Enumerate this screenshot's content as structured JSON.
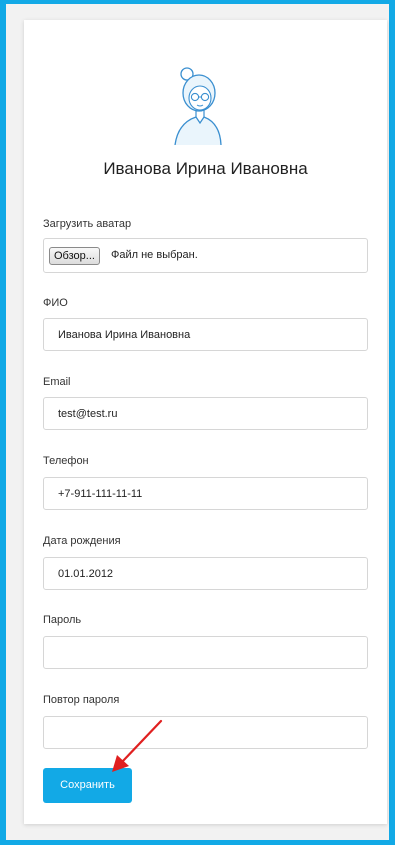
{
  "profile": {
    "name": "Иванова Ирина Ивановна"
  },
  "form": {
    "avatar_label": "Загрузить аватар",
    "browse_label": "Обзор...",
    "file_status": "Файл не выбран.",
    "fio_label": "ФИО",
    "fio_value": "Иванова Ирина Ивановна",
    "email_label": "Email",
    "email_value": "test@test.ru",
    "phone_label": "Телефон",
    "phone_value": "+7-911-111-11-11",
    "birth_label": "Дата рождения",
    "birth_value": "01.01.2012",
    "password_label": "Пароль",
    "password_value": "",
    "repeat_label": "Повтор пароля",
    "repeat_value": "",
    "save_label": "Сохранить"
  },
  "colors": {
    "accent": "#12a9e6",
    "arrow": "#e02020"
  },
  "icons": {
    "avatar": "user-avatar-icon",
    "arrow": "red-arrow-annotation-icon"
  }
}
